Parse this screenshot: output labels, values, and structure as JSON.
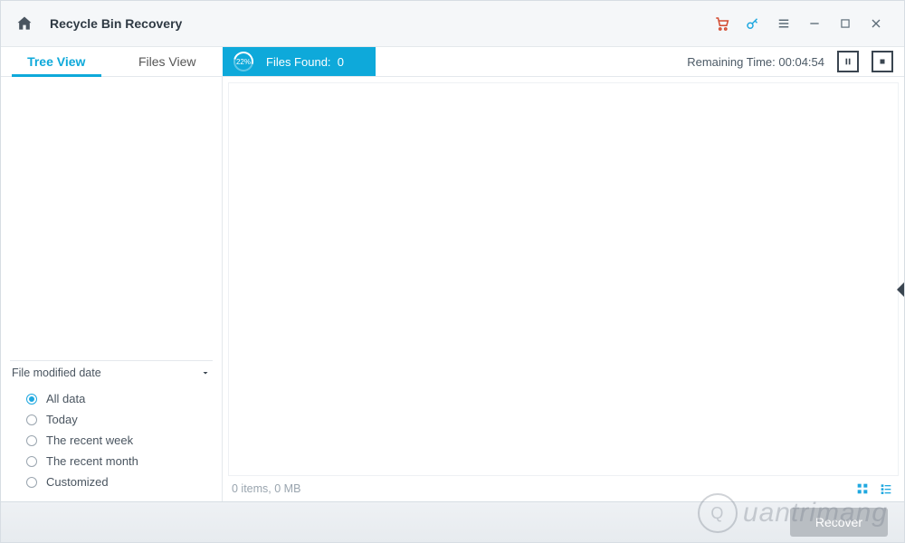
{
  "titlebar": {
    "title": "Recycle Bin Recovery"
  },
  "tabs": {
    "tree": "Tree View",
    "files": "Files View",
    "active": "tree"
  },
  "scan": {
    "percent_label": "22%",
    "found_label": "Files Found:",
    "found_count": "0",
    "remaining_label": "Remaining Time:",
    "remaining_value": "00:04:54"
  },
  "filter": {
    "header": "File modified date",
    "options": [
      "All data",
      "Today",
      "The recent week",
      "The recent month",
      "Customized"
    ],
    "selected_index": 0
  },
  "status": {
    "summary": "0 items, 0 MB"
  },
  "buttons": {
    "recover": "Recover"
  },
  "watermark": {
    "text": "uantrimang",
    "bulb": "Q"
  }
}
